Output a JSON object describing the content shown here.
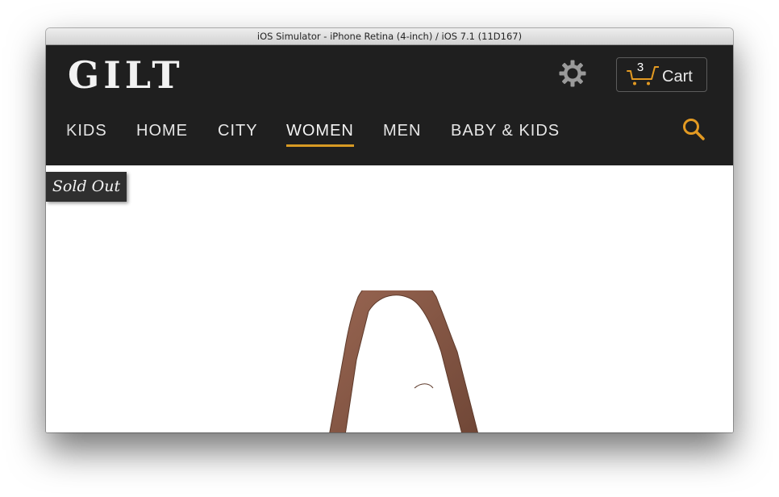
{
  "window": {
    "title": "iOS Simulator - iPhone Retina (4-inch) / iOS 7.1 (11D167)"
  },
  "header": {
    "logo": "GILT",
    "settings_icon": "gear-icon",
    "cart": {
      "count": "3",
      "label": "Cart",
      "icon": "cart-icon"
    }
  },
  "nav": {
    "items": [
      {
        "label": "KIDS"
      },
      {
        "label": "HOME"
      },
      {
        "label": "CITY"
      },
      {
        "label": "WOMEN",
        "active": true
      },
      {
        "label": "MEN"
      },
      {
        "label": "BABY & KIDS"
      }
    ],
    "search_icon": "search-icon"
  },
  "product": {
    "badge": "Sold Out",
    "image": "brown-handbag-image"
  },
  "colors": {
    "header_bg": "#1f1f1f",
    "accent": "#d89a24",
    "text": "#e6e6e6",
    "badge_bg": "#2f2f2f",
    "product": "#8b5a47"
  }
}
